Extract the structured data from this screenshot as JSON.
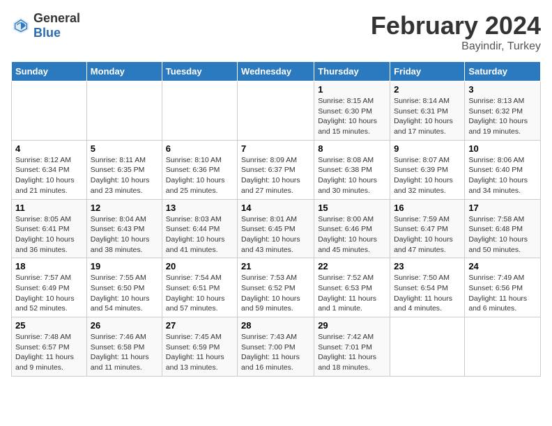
{
  "header": {
    "logo_general": "General",
    "logo_blue": "Blue",
    "title": "February 2024",
    "subtitle": "Bayindir, Turkey"
  },
  "days_of_week": [
    "Sunday",
    "Monday",
    "Tuesday",
    "Wednesday",
    "Thursday",
    "Friday",
    "Saturday"
  ],
  "weeks": [
    [
      {
        "day": "",
        "sunrise": "",
        "sunset": "",
        "daylight": ""
      },
      {
        "day": "",
        "sunrise": "",
        "sunset": "",
        "daylight": ""
      },
      {
        "day": "",
        "sunrise": "",
        "sunset": "",
        "daylight": ""
      },
      {
        "day": "",
        "sunrise": "",
        "sunset": "",
        "daylight": ""
      },
      {
        "day": "1",
        "sunrise": "8:15 AM",
        "sunset": "6:30 PM",
        "daylight": "10 hours and 15 minutes."
      },
      {
        "day": "2",
        "sunrise": "8:14 AM",
        "sunset": "6:31 PM",
        "daylight": "10 hours and 17 minutes."
      },
      {
        "day": "3",
        "sunrise": "8:13 AM",
        "sunset": "6:32 PM",
        "daylight": "10 hours and 19 minutes."
      }
    ],
    [
      {
        "day": "4",
        "sunrise": "8:12 AM",
        "sunset": "6:34 PM",
        "daylight": "10 hours and 21 minutes."
      },
      {
        "day": "5",
        "sunrise": "8:11 AM",
        "sunset": "6:35 PM",
        "daylight": "10 hours and 23 minutes."
      },
      {
        "day": "6",
        "sunrise": "8:10 AM",
        "sunset": "6:36 PM",
        "daylight": "10 hours and 25 minutes."
      },
      {
        "day": "7",
        "sunrise": "8:09 AM",
        "sunset": "6:37 PM",
        "daylight": "10 hours and 27 minutes."
      },
      {
        "day": "8",
        "sunrise": "8:08 AM",
        "sunset": "6:38 PM",
        "daylight": "10 hours and 30 minutes."
      },
      {
        "day": "9",
        "sunrise": "8:07 AM",
        "sunset": "6:39 PM",
        "daylight": "10 hours and 32 minutes."
      },
      {
        "day": "10",
        "sunrise": "8:06 AM",
        "sunset": "6:40 PM",
        "daylight": "10 hours and 34 minutes."
      }
    ],
    [
      {
        "day": "11",
        "sunrise": "8:05 AM",
        "sunset": "6:41 PM",
        "daylight": "10 hours and 36 minutes."
      },
      {
        "day": "12",
        "sunrise": "8:04 AM",
        "sunset": "6:43 PM",
        "daylight": "10 hours and 38 minutes."
      },
      {
        "day": "13",
        "sunrise": "8:03 AM",
        "sunset": "6:44 PM",
        "daylight": "10 hours and 41 minutes."
      },
      {
        "day": "14",
        "sunrise": "8:01 AM",
        "sunset": "6:45 PM",
        "daylight": "10 hours and 43 minutes."
      },
      {
        "day": "15",
        "sunrise": "8:00 AM",
        "sunset": "6:46 PM",
        "daylight": "10 hours and 45 minutes."
      },
      {
        "day": "16",
        "sunrise": "7:59 AM",
        "sunset": "6:47 PM",
        "daylight": "10 hours and 47 minutes."
      },
      {
        "day": "17",
        "sunrise": "7:58 AM",
        "sunset": "6:48 PM",
        "daylight": "10 hours and 50 minutes."
      }
    ],
    [
      {
        "day": "18",
        "sunrise": "7:57 AM",
        "sunset": "6:49 PM",
        "daylight": "10 hours and 52 minutes."
      },
      {
        "day": "19",
        "sunrise": "7:55 AM",
        "sunset": "6:50 PM",
        "daylight": "10 hours and 54 minutes."
      },
      {
        "day": "20",
        "sunrise": "7:54 AM",
        "sunset": "6:51 PM",
        "daylight": "10 hours and 57 minutes."
      },
      {
        "day": "21",
        "sunrise": "7:53 AM",
        "sunset": "6:52 PM",
        "daylight": "10 hours and 59 minutes."
      },
      {
        "day": "22",
        "sunrise": "7:52 AM",
        "sunset": "6:53 PM",
        "daylight": "11 hours and 1 minute."
      },
      {
        "day": "23",
        "sunrise": "7:50 AM",
        "sunset": "6:54 PM",
        "daylight": "11 hours and 4 minutes."
      },
      {
        "day": "24",
        "sunrise": "7:49 AM",
        "sunset": "6:56 PM",
        "daylight": "11 hours and 6 minutes."
      }
    ],
    [
      {
        "day": "25",
        "sunrise": "7:48 AM",
        "sunset": "6:57 PM",
        "daylight": "11 hours and 9 minutes."
      },
      {
        "day": "26",
        "sunrise": "7:46 AM",
        "sunset": "6:58 PM",
        "daylight": "11 hours and 11 minutes."
      },
      {
        "day": "27",
        "sunrise": "7:45 AM",
        "sunset": "6:59 PM",
        "daylight": "11 hours and 13 minutes."
      },
      {
        "day": "28",
        "sunrise": "7:43 AM",
        "sunset": "7:00 PM",
        "daylight": "11 hours and 16 minutes."
      },
      {
        "day": "29",
        "sunrise": "7:42 AM",
        "sunset": "7:01 PM",
        "daylight": "11 hours and 18 minutes."
      },
      {
        "day": "",
        "sunrise": "",
        "sunset": "",
        "daylight": ""
      },
      {
        "day": "",
        "sunrise": "",
        "sunset": "",
        "daylight": ""
      }
    ]
  ]
}
